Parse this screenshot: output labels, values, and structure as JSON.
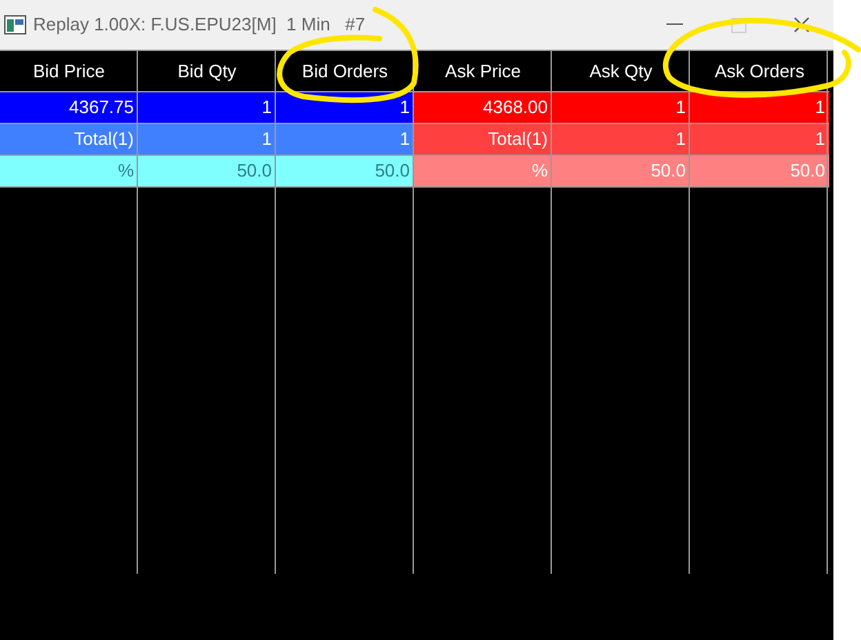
{
  "window": {
    "title": "Replay 1.00X: F.US.EPU23[M]  1 Min   #7",
    "maximize_disabled": true
  },
  "table": {
    "columns": [
      "Bid Price",
      "Bid Qty",
      "Bid Orders",
      "Ask Price",
      "Ask Qty",
      "Ask Orders"
    ],
    "rows": [
      {
        "kind": "price",
        "cells": [
          "4367.75",
          "1",
          "1",
          "4368.00",
          "1",
          "1"
        ]
      },
      {
        "kind": "total",
        "cells": [
          "Total(1)",
          "1",
          "1",
          "Total(1)",
          "1",
          "1"
        ]
      },
      {
        "kind": "percent",
        "cells": [
          "%",
          "50.0",
          "50.0",
          "%",
          "50.0",
          "50.0"
        ]
      }
    ]
  }
}
